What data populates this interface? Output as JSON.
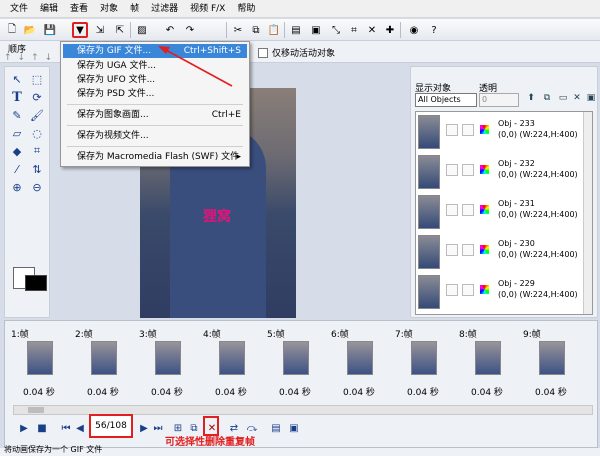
{
  "menubar": [
    "文件",
    "编辑",
    "查看",
    "对象",
    "帧",
    "过滤器",
    "视频 F/X",
    "帮助"
  ],
  "toolbar": {
    "icons": [
      "new-icon",
      "open-icon",
      "save-icon",
      "save-dropdown-icon",
      "import-icon",
      "export-icon",
      "optimize-icon",
      "undo-icon",
      "redo-icon",
      "cut-icon",
      "copy-icon",
      "paste-icon",
      "select-frame-icon",
      "add-frame-icon",
      "resize-icon",
      "crop-icon",
      "delete-icon",
      "add-icon",
      "preview-icon",
      "help-icon"
    ]
  },
  "subbar": {
    "label": "顺序",
    "checkbox_label": "仅移动活动对象"
  },
  "dropdown_menu": {
    "items": [
      {
        "label": "保存为 GIF 文件...",
        "shortcut": "Ctrl+Shift+S"
      },
      {
        "label": "保存为 UGA 文件...",
        "shortcut": ""
      },
      {
        "label": "保存为 UFO 文件...",
        "shortcut": ""
      },
      {
        "label": "保存为 PSD 文件...",
        "shortcut": ""
      },
      {
        "label": "保存为图象画面...",
        "shortcut": "Ctrl+E"
      },
      {
        "label": "保存为视频文件...",
        "shortcut": ""
      },
      {
        "label": "保存为 Macromedia Flash (SWF) 文件",
        "shortcut": ""
      }
    ]
  },
  "canvas": {
    "watermark": "狸窝"
  },
  "right_panel": {
    "label_objects": "显示对象",
    "label_opacity": "透明",
    "object_select": "All Objects",
    "opacity_value": "0",
    "objects": [
      {
        "name": "Obj - 233",
        "info": "(0,0) (W:224,H:400)"
      },
      {
        "name": "Obj - 232",
        "info": "(0,0) (W:224,H:400)"
      },
      {
        "name": "Obj - 231",
        "info": "(0,0) (W:224,H:400)"
      },
      {
        "name": "Obj - 230",
        "info": "(0,0) (W:224,H:400)"
      },
      {
        "name": "Obj - 229",
        "info": "(0,0) (W:224,H:400)"
      }
    ]
  },
  "frames": [
    {
      "label": "1:帧",
      "delay": "0.04 秒"
    },
    {
      "label": "2:帧",
      "delay": "0.04 秒"
    },
    {
      "label": "3:帧",
      "delay": "0.04 秒"
    },
    {
      "label": "4:帧",
      "delay": "0.04 秒"
    },
    {
      "label": "5:帧",
      "delay": "0.04 秒"
    },
    {
      "label": "6:帧",
      "delay": "0.04 秒"
    },
    {
      "label": "7:帧",
      "delay": "0.04 秒"
    },
    {
      "label": "8:帧",
      "delay": "0.04 秒"
    },
    {
      "label": "9:帧",
      "delay": "0.04 秒"
    }
  ],
  "playback": {
    "frame_counter": "56/108",
    "annotation": "可选择性删除重复帧"
  },
  "statusbar": {
    "text": "将动画保存为一个 GIF 文件"
  },
  "colors": {
    "highlight_red": "#e02020",
    "menu_highlight": "#3a86d8",
    "watermark": "#e0157a"
  }
}
